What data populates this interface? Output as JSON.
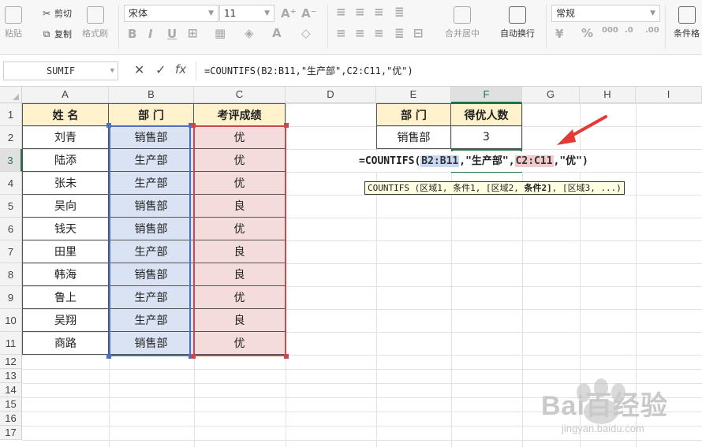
{
  "ribbon": {
    "paste_label": "粘贴",
    "cut_label": "剪切",
    "copy_label": "复制",
    "format_painter_label": "格式刷",
    "font_name": "宋体",
    "font_size": "11",
    "merge_center_label": "合并居中",
    "wrap_text_label": "自动换行",
    "number_format": "常规",
    "conditional_label": "条件格"
  },
  "formula_bar": {
    "name_box": "SUMIF",
    "fx_label": "fx",
    "formula": "=COUNTIFS(B2:B11,\"生产部\",C2:C11,\"优\")"
  },
  "columns": [
    "A",
    "B",
    "C",
    "D",
    "E",
    "F",
    "G",
    "H",
    "I"
  ],
  "rows": [
    "1",
    "2",
    "3",
    "4",
    "5",
    "6",
    "7",
    "8",
    "9",
    "10",
    "11",
    "12",
    "13",
    "14",
    "15",
    "16",
    "17"
  ],
  "table": {
    "headers": [
      "姓 名",
      "部 门",
      "考评成绩"
    ],
    "names": [
      "刘青",
      "陆添",
      "张未",
      "吴向",
      "钱天",
      "田里",
      "韩海",
      "鲁上",
      "吴翔",
      "商路"
    ],
    "depts": [
      "销售部",
      "生产部",
      "生产部",
      "销售部",
      "销售部",
      "生产部",
      "销售部",
      "生产部",
      "生产部",
      "销售部"
    ],
    "grades": [
      "优",
      "优",
      "优",
      "良",
      "优",
      "良",
      "良",
      "优",
      "良",
      "优"
    ]
  },
  "summary": {
    "header_dept": "部 门",
    "header_count": "得优人数",
    "dept": "销售部",
    "count": "3"
  },
  "editing": {
    "prefix": "=COUNTIFS(",
    "range1": "B2:B11",
    "mid": ",\"生产部\",",
    "range2": "C2:C11",
    "suffix": ",\"优\")",
    "tooltip_a": "COUNTIFS (区域1, 条件1, [区域2, ",
    "tooltip_bold": "条件2]",
    "tooltip_b": ", [区域3, ...)"
  },
  "watermark": {
    "brand": "Bai百经验",
    "url": "jingyan.baidu.com"
  }
}
